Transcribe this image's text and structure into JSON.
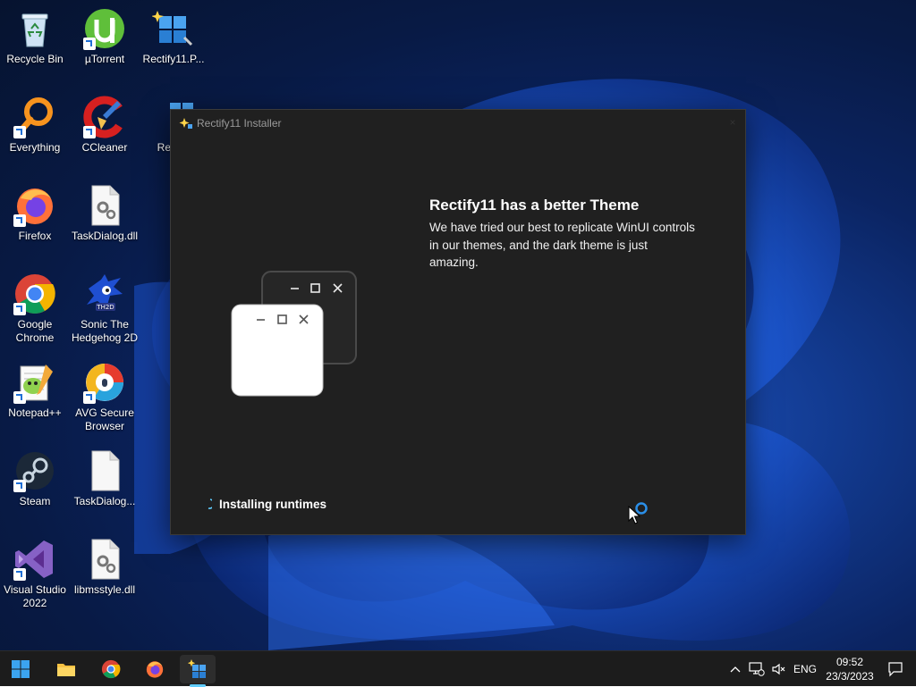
{
  "desktop_icons": [
    {
      "label": "Recycle Bin",
      "icon": "recycle-bin-icon"
    },
    {
      "label": "µTorrent",
      "icon": "utorrent-icon"
    },
    {
      "label": "Rectify11.P...",
      "icon": "rectify11-icon"
    },
    {
      "label": "Everything",
      "icon": "everything-icon"
    },
    {
      "label": "CCleaner",
      "icon": "ccleaner-icon"
    },
    {
      "label": "Rectify",
      "icon": "rectify11-icon"
    },
    {
      "label": "Firefox",
      "icon": "firefox-icon"
    },
    {
      "label": "TaskDialog.dll",
      "icon": "dll-file-icon"
    },
    {
      "label": "Google Chrome",
      "icon": "chrome-icon"
    },
    {
      "label": "Sonic The Hedgehog 2D",
      "icon": "sonic-icon"
    },
    {
      "label": "Notepad++",
      "icon": "notepadpp-icon"
    },
    {
      "label": "AVG Secure Browser",
      "icon": "avg-browser-icon"
    },
    {
      "label": "Steam",
      "icon": "steam-icon"
    },
    {
      "label": "TaskDialog...",
      "icon": "blank-file-icon"
    },
    {
      "label": "Visual Studio 2022",
      "icon": "visual-studio-icon"
    },
    {
      "label": "libmsstyle.dll",
      "icon": "dll-file-icon"
    }
  ],
  "installer": {
    "title": "Rectify11 Installer",
    "close_glyph": "×",
    "heading": "Rectify11 has a better Theme",
    "description": "We have tried our best to replicate WinUI controls in our themes, and the dark theme is just amazing.",
    "status": "Installing runtimes"
  },
  "taskbar": {
    "apps": [
      "start-icon",
      "file-explorer-icon",
      "chrome-icon",
      "firefox-icon",
      "rectify11-installer-icon"
    ],
    "tray": {
      "chevron": "^",
      "language": "ENG"
    },
    "clock": {
      "time": "09:52",
      "date": "23/3/2023"
    }
  },
  "colors": {
    "window_bg": "#202020",
    "accent": "#60cdff",
    "taskbar_bg": "#1c1c1c"
  }
}
